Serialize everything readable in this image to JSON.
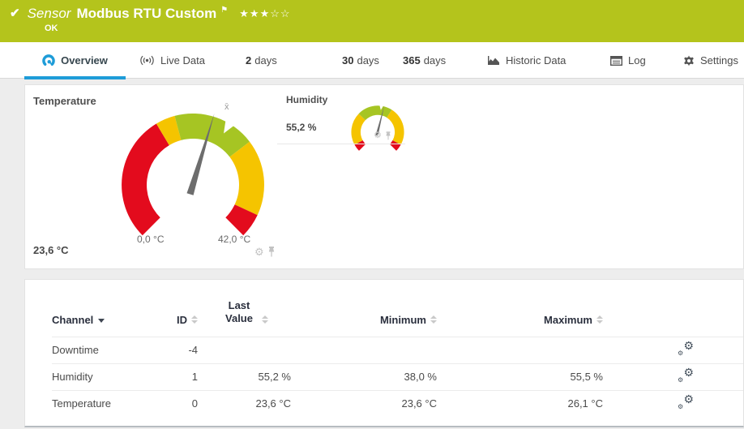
{
  "colors": {
    "header_green": "#b4c41c",
    "accent_blue": "#1e9cd8",
    "gauge_red": "#e30b1d",
    "gauge_yellow": "#f5c400",
    "gauge_green": "#a6c523",
    "needle_gray": "#6d6d6d"
  },
  "header": {
    "sensor_label": "Sensor",
    "title": "Modbus RTU Custom",
    "status": "OK",
    "rating_filled": 3,
    "rating_total": 5
  },
  "tabs": {
    "items": [
      {
        "id": "overview",
        "label": "Overview",
        "icon": "gauge-icon",
        "active": true
      },
      {
        "id": "live-data",
        "label": "Live Data",
        "icon": "live-icon",
        "active": false
      },
      {
        "id": "2-days",
        "prefix": "2",
        "label": "days",
        "active": false
      },
      {
        "id": "30-days",
        "prefix": "30",
        "label": "days",
        "active": false
      },
      {
        "id": "365-days",
        "prefix": "365",
        "label": "days",
        "active": false
      },
      {
        "id": "historic-data",
        "label": "Historic Data",
        "icon": "historic-chart-icon",
        "active": false
      },
      {
        "id": "log",
        "label": "Log",
        "icon": "log-icon",
        "active": false
      },
      {
        "id": "settings",
        "label": "Settings",
        "icon": "settings-gear-icon",
        "active": false
      }
    ]
  },
  "gauges": {
    "temperature": {
      "title": "Temperature",
      "value": "23,6 °C",
      "min_label": "0,0 °C",
      "max_label": "42,0 °C",
      "avg_marker": "x̄"
    },
    "humidity": {
      "title": "Humidity",
      "value": "55,2 %"
    }
  },
  "chart_data": [
    {
      "type": "gauge",
      "name": "Temperature",
      "unit": "°C",
      "min": 0,
      "max": 42,
      "value": 23.6,
      "average_marker": 25.8,
      "segments": [
        {
          "from": 0,
          "to": 16.2,
          "color": "#e30b1d"
        },
        {
          "from": 16.2,
          "to": 18.7,
          "color": "#f5c400"
        },
        {
          "from": 18.7,
          "to": 29.2,
          "color": "#a6c523"
        },
        {
          "from": 29.2,
          "to": 38.9,
          "color": "#f5c400"
        },
        {
          "from": 38.9,
          "to": 42,
          "color": "#e30b1d"
        }
      ]
    },
    {
      "type": "gauge",
      "name": "Humidity",
      "unit": "%",
      "min": 0,
      "max": 100,
      "value": 55.2,
      "average_marker": 53,
      "segments": [
        {
          "from": 0,
          "to": 6,
          "color": "#e30b1d"
        },
        {
          "from": 6,
          "to": 33,
          "color": "#f5c400"
        },
        {
          "from": 33,
          "to": 62,
          "color": "#a6c523"
        },
        {
          "from": 62,
          "to": 94,
          "color": "#f5c400"
        },
        {
          "from": 94,
          "to": 100,
          "color": "#e30b1d"
        }
      ]
    }
  ],
  "table": {
    "columns": [
      {
        "key": "channel",
        "label": "Channel",
        "sort": "active-desc"
      },
      {
        "key": "id",
        "label": "ID",
        "sort": "both"
      },
      {
        "key": "last",
        "label": "Last Value",
        "sort": "both",
        "wrap": true
      },
      {
        "key": "min",
        "label": "Minimum",
        "sort": "both"
      },
      {
        "key": "max",
        "label": "Maximum",
        "sort": "both"
      }
    ],
    "rows": [
      {
        "channel": "Downtime",
        "id": "-4",
        "last": "",
        "min": "",
        "max": ""
      },
      {
        "channel": "Humidity",
        "id": "1",
        "last": "55,2 %",
        "min": "38,0 %",
        "max": "55,5 %"
      },
      {
        "channel": "Temperature",
        "id": "0",
        "last": "23,6 °C",
        "min": "23,6 °C",
        "max": "26,1 °C"
      }
    ]
  }
}
